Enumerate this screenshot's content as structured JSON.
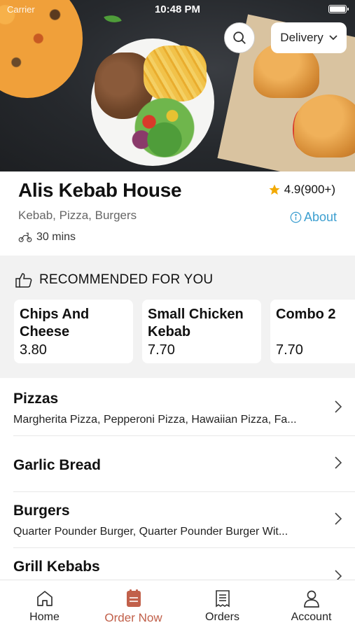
{
  "status_bar": {
    "carrier": "Carrier",
    "time": "10:48 PM"
  },
  "header": {
    "delivery_mode": "Delivery"
  },
  "restaurant": {
    "name": "Alis Kebab House",
    "rating": "4.9(900+)",
    "cuisine": "Kebab, Pizza, Burgers",
    "about_label": "About",
    "eta": "30 mins"
  },
  "recommended": {
    "title": "RECOMMENDED FOR YOU",
    "items": [
      {
        "name": "Chips And Cheese",
        "price": "3.80"
      },
      {
        "name": "Small Chicken Kebab",
        "price": "7.70"
      },
      {
        "name": "Combo 2",
        "price": "7.70"
      }
    ]
  },
  "categories": [
    {
      "title": "Pizzas",
      "description": "Margherita Pizza, Pepperoni Pizza, Hawaiian Pizza, Fa..."
    },
    {
      "title": "Garlic Bread",
      "description": ""
    },
    {
      "title": "Burgers",
      "description": "Quarter Pounder Burger, Quarter Pounder Burger Wit..."
    },
    {
      "title": "Grill Kebabs",
      "description": ""
    }
  ],
  "tabs": [
    {
      "label": "Home",
      "icon": "home-icon"
    },
    {
      "label": "Order Now",
      "icon": "order-icon",
      "active": true
    },
    {
      "label": "Orders",
      "icon": "receipt-icon"
    },
    {
      "label": "Account",
      "icon": "user-icon"
    }
  ],
  "colors": {
    "accent": "#c1604a",
    "link": "#3d9fd0",
    "star": "#f2a900",
    "section_bg": "#f2f2f2"
  }
}
